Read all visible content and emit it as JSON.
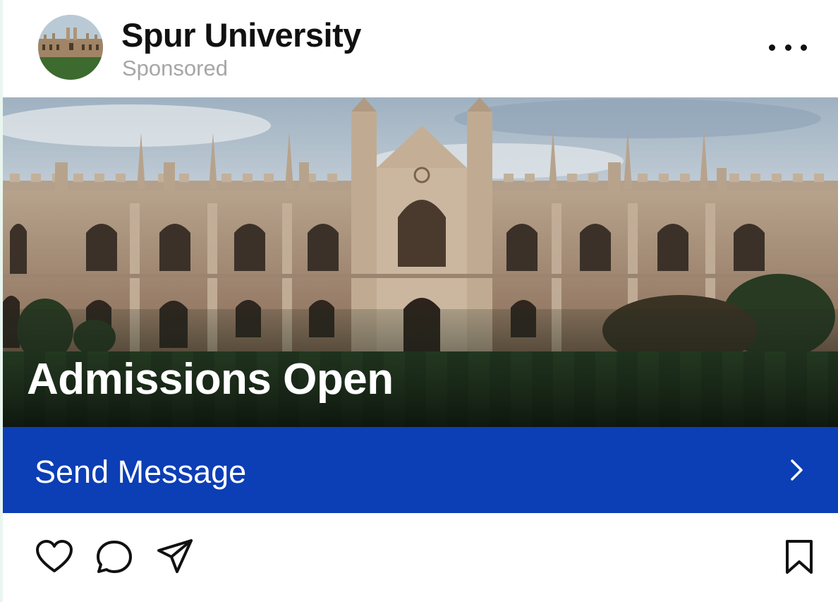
{
  "post": {
    "account_name": "Spur University",
    "sponsored_label": "Sponsored",
    "more_icon": "more-horizontal-icon"
  },
  "media": {
    "headline": "Admissions Open",
    "image": "university-building-photo"
  },
  "cta": {
    "label": "Send Message",
    "icon": "chevron-right-icon",
    "color": "#0c3eb5"
  },
  "actions": {
    "icons": [
      "heart-icon",
      "comment-icon",
      "send-icon",
      "bookmark-icon"
    ]
  }
}
